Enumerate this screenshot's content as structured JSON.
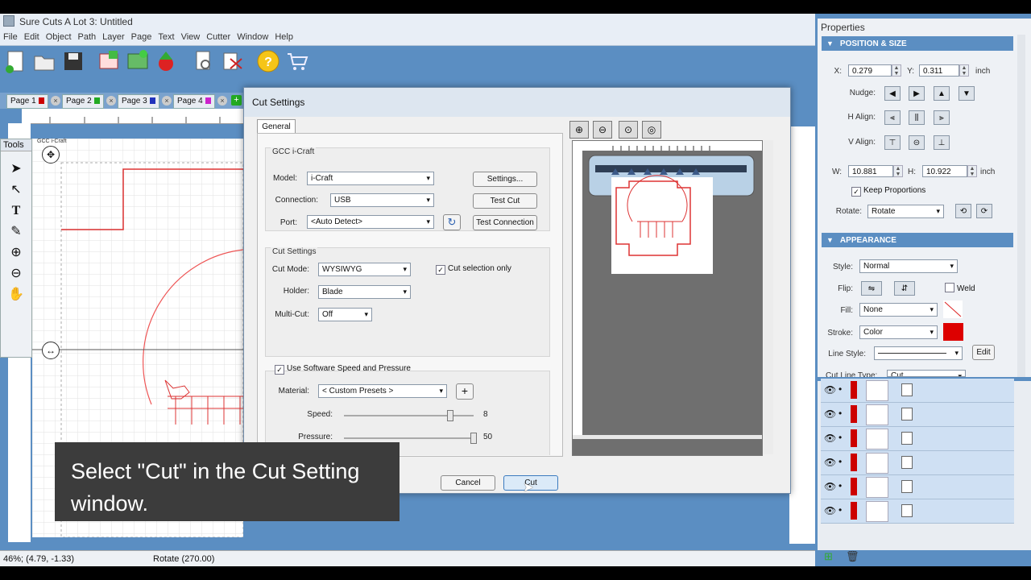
{
  "window": {
    "title": "Sure Cuts A Lot 3: Untitled"
  },
  "menu": [
    "File",
    "Edit",
    "Object",
    "Path",
    "Layer",
    "Page",
    "Text",
    "View",
    "Cutter",
    "Window",
    "Help"
  ],
  "page_tabs": [
    {
      "label": "Page 1",
      "color": "#cc0000"
    },
    {
      "label": "Page 2",
      "color": "#22aa22"
    },
    {
      "label": "Page 3",
      "color": "#2233bb"
    },
    {
      "label": "Page 4",
      "color": "#cc22cc"
    }
  ],
  "tools_title": "Tools",
  "canvas_label": "GCC i-Craft",
  "properties": {
    "title": "Properties",
    "position_section": "POSITION & SIZE",
    "x_label": "X:",
    "x_value": "0.279",
    "y_label": "Y:",
    "y_value": "0.311",
    "unit1": "inch",
    "nudge_label": "Nudge:",
    "halign_label": "H Align:",
    "valign_label": "V Align:",
    "w_label": "W:",
    "w_value": "10.881",
    "h_label": "H:",
    "h_value": "10.922",
    "unit2": "inch",
    "keep_proportions": "Keep Proportions",
    "rotate_label": "Rotate:",
    "rotate_value": "Rotate",
    "appearance_section": "APPEARANCE",
    "style_label": "Style:",
    "style_value": "Normal",
    "flip_label": "Flip:",
    "weld_label": "Weld",
    "fill_label": "Fill:",
    "fill_value": "None",
    "stroke_label": "Stroke:",
    "stroke_value": "Color",
    "stroke_color": "#dd0000",
    "line_style_label": "Line Style:",
    "edit_label": "Edit",
    "cut_line_type_label": "Cut Line Type:",
    "cut_line_type_value": "Cut"
  },
  "layers_count": 6,
  "status": {
    "left": "46%; (4.79, -1.33)",
    "right": "Rotate (270.00)"
  },
  "dialog": {
    "title": "Cut Settings",
    "tab": "General",
    "group_device": "GCC i-Craft",
    "model_label": "Model:",
    "model_value": "i-Craft",
    "connection_label": "Connection:",
    "connection_value": "USB",
    "port_label": "Port:",
    "port_value": "<Auto Detect>",
    "settings_btn": "Settings...",
    "test_cut_btn": "Test Cut",
    "test_connection_btn": "Test Connection",
    "group_cut": "Cut Settings",
    "cut_mode_label": "Cut Mode:",
    "cut_mode_value": "WYSIWYG",
    "cut_selection_only": "Cut selection only",
    "holder_label": "Holder:",
    "holder_value": "Blade",
    "multicut_label": "Multi-Cut:",
    "multicut_value": "Off",
    "use_software": "Use Software Speed and Pressure",
    "material_label": "Material:",
    "material_value": "< Custom Presets >",
    "speed_label": "Speed:",
    "speed_value": "8",
    "pressure_label": "Pressure:",
    "pressure_value": "50",
    "cancel_btn": "Cancel",
    "cut_btn": "Cut",
    "speed_fraction": 0.82,
    "pressure_fraction": 1.0
  },
  "caption": "Select \"Cut\" in the Cut Setting window."
}
